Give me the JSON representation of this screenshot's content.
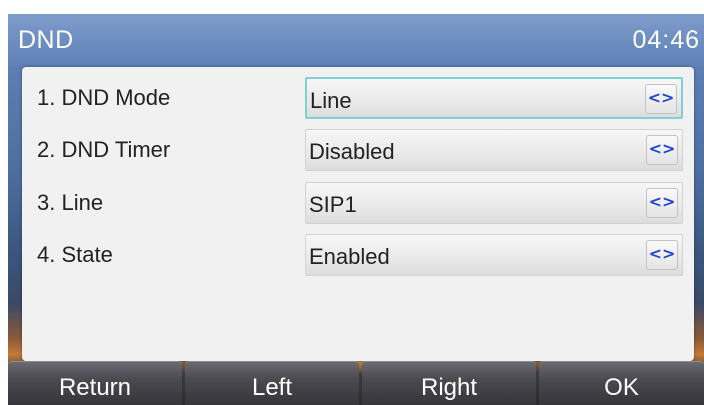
{
  "header": {
    "title": "DND",
    "clock": "04:46"
  },
  "settings": [
    {
      "label": "1. DND Mode",
      "value": "Line",
      "focused": true
    },
    {
      "label": "2. DND Timer",
      "value": "Disabled",
      "focused": false
    },
    {
      "label": "3. Line",
      "value": "SIP1",
      "focused": false
    },
    {
      "label": "4. State",
      "value": "Enabled",
      "focused": false
    }
  ],
  "arrow_glyph": "<>",
  "softkeys": {
    "return": "Return",
    "left": "Left",
    "right": "Right",
    "ok": "OK"
  },
  "colors": {
    "title_bar": "#6c8dc0",
    "focus_border": "#7fd0d6",
    "arrow": "#1e46c8"
  }
}
